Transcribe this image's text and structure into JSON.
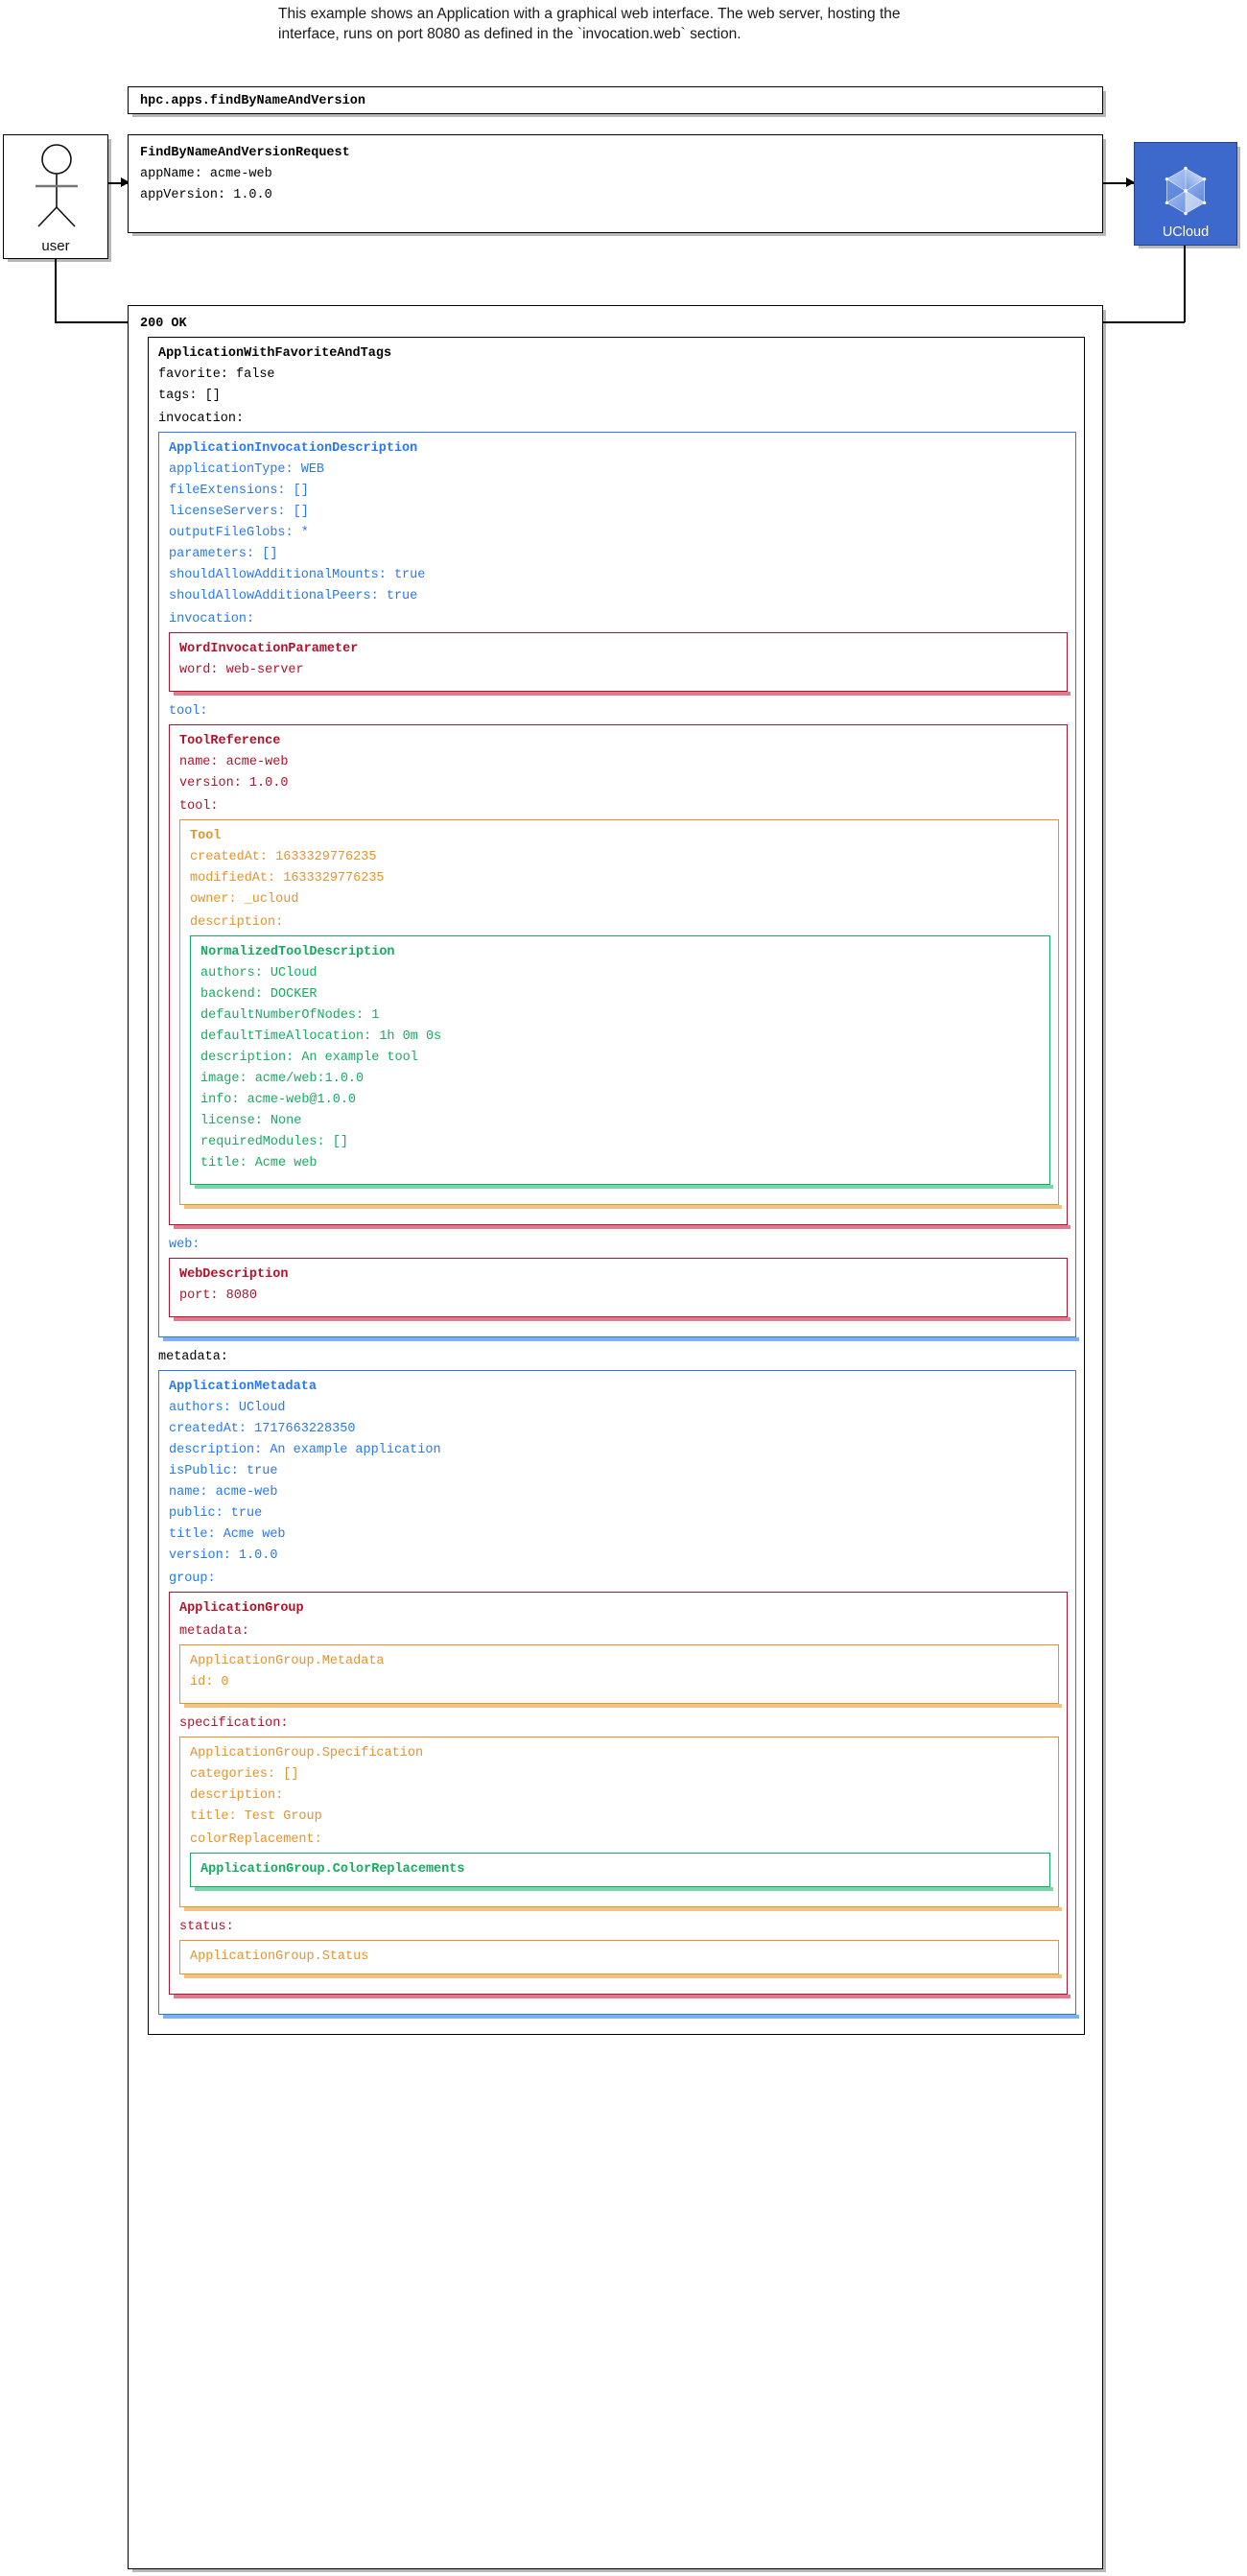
{
  "caption": {
    "line1": "This example shows an Application with a graphical web interface. The web server, hosting the",
    "line2": "interface, runs on port 8080 as defined in the `invocation.web` section."
  },
  "actor": {
    "label": "user",
    "icon": "stick-figure-icon"
  },
  "system": {
    "label": "UCloud",
    "icon": "ucloud-logo-icon",
    "color": "#3d68cc"
  },
  "call": {
    "name": "hpc.apps.findByNameAndVersion"
  },
  "request": {
    "type": "FindByNameAndVersionRequest",
    "fields": [
      "appName: acme-web",
      "appVersion: 1.0.0"
    ]
  },
  "response": {
    "status": "200 OK",
    "type": "ApplicationWithFavoriteAndTags",
    "fields": [
      "favorite: false",
      "tags: []"
    ],
    "invocation_label": "invocation:",
    "invocation": {
      "type": "ApplicationInvocationDescription",
      "color": "#2878f0",
      "fields": [
        "applicationType: WEB",
        "fileExtensions: []",
        "licenseServers: []",
        "outputFileGlobs: *",
        "parameters: []",
        "shouldAllowAdditionalMounts: true",
        "shouldAllowAdditionalPeers: true"
      ],
      "invocation_label": "invocation:",
      "word_param": {
        "type": "WordInvocationParameter",
        "color": "#b3122b",
        "fields": [
          "word: web-server"
        ]
      },
      "tool_label": "tool:",
      "tool_reference": {
        "type": "ToolReference",
        "color": "#b3122b",
        "fields": [
          "name: acme-web",
          "version: 1.0.0"
        ],
        "tool_label": "tool:",
        "tool": {
          "type": "Tool",
          "color": "#e8922e",
          "fields": [
            "createdAt: 1633329776235",
            "modifiedAt: 1633329776235",
            "owner: _ucloud"
          ],
          "description_label": "description:",
          "description": {
            "type": "NormalizedToolDescription",
            "color": "#17ab62",
            "fields": [
              "authors: UCloud",
              "backend: DOCKER",
              "defaultNumberOfNodes: 1",
              "defaultTimeAllocation: 1h 0m 0s",
              "description: An example tool",
              "image: acme/web:1.0.0",
              "info: acme-web@1.0.0",
              "license: None",
              "requiredModules: []",
              "title: Acme web"
            ]
          }
        }
      },
      "web_label": "web:",
      "web": {
        "type": "WebDescription",
        "color": "#b3122b",
        "fields": [
          "port: 8080"
        ]
      }
    },
    "metadata_label": "metadata:",
    "metadata": {
      "type": "ApplicationMetadata",
      "color": "#2878f0",
      "fields": [
        "authors: UCloud",
        "createdAt: 1717663228350",
        "description: An example application",
        "isPublic: true",
        "name: acme-web",
        "public: true",
        "title: Acme web",
        "version: 1.0.0"
      ],
      "group_label": "group:",
      "group": {
        "type": "ApplicationGroup",
        "color": "#b3122b",
        "metadata_label": "metadata:",
        "group_metadata": {
          "type": "ApplicationGroup.Metadata",
          "color": "#e8922e",
          "fields": [
            "id: 0"
          ]
        },
        "specification_label": "specification:",
        "group_specification": {
          "type": "ApplicationGroup.Specification",
          "color": "#e8922e",
          "fields": [
            "categories: []",
            "description:",
            "title: Test Group"
          ],
          "color_replacement_label": "colorReplacement:",
          "color_replacements": {
            "type": "ApplicationGroup.ColorReplacements",
            "color": "#17ab62",
            "fields": []
          }
        },
        "status_label": "status:",
        "group_status": {
          "type": "ApplicationGroup.Status",
          "color": "#e8922e",
          "fields": []
        }
      }
    }
  }
}
